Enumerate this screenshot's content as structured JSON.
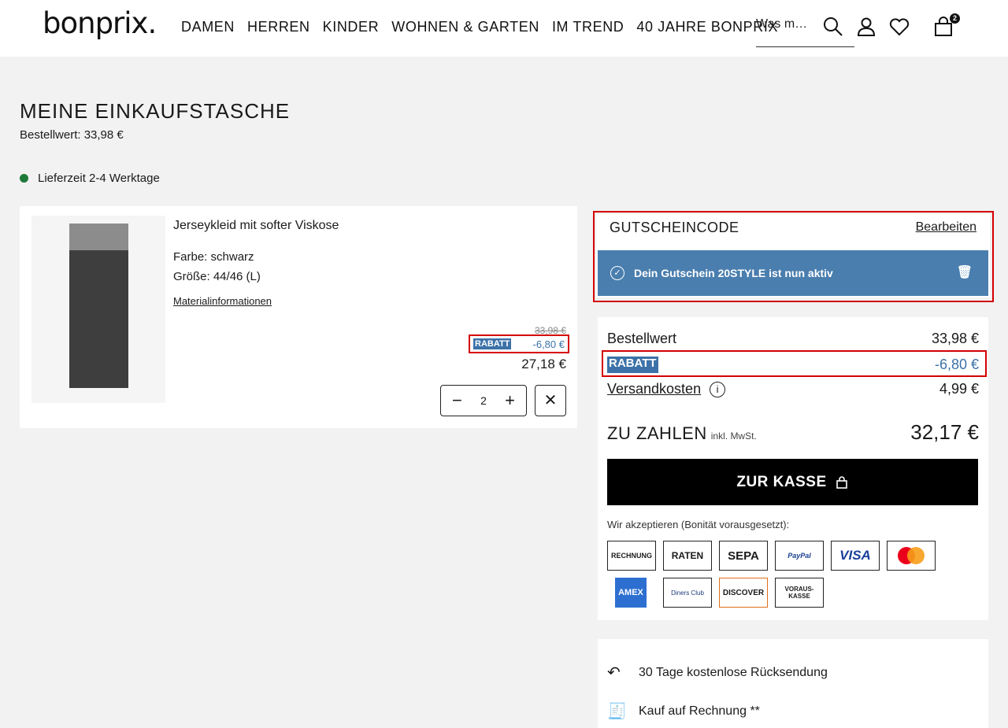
{
  "header": {
    "logo": "bonprix.",
    "nav": [
      "DAMEN",
      "HERREN",
      "KINDER",
      "WOHNEN & GARTEN",
      "IM TREND",
      "40 JAHRE BONPRIX"
    ],
    "search_placeholder": "Was m…",
    "cart_count": "2",
    "icons": [
      "search-icon",
      "user-icon",
      "heart-icon",
      "bag-icon"
    ]
  },
  "page": {
    "title": "MEINE EINKAUFSTASCHE",
    "order_value": "Bestellwert: 33,98 €",
    "delivery": "Lieferzeit 2-4 Werktage"
  },
  "item": {
    "name": "Jerseykleid mit softer Viskose",
    "color": "Farbe: schwarz",
    "size": "Größe: 44/46 (L)",
    "material_link": "Materialinformationen",
    "old_price": "33,98 €",
    "discount_tag": "RABATT",
    "discount": "-6,80 €",
    "price": "27,18 €",
    "quantity": "2",
    "minus": "−",
    "plus": "+",
    "remove": "✕"
  },
  "voucher": {
    "title": "GUTSCHEINCODE",
    "edit": "Bearbeiten",
    "message": "Dein Gutschein 20STYLE ist nun aktiv"
  },
  "summary": {
    "order_value_label": "Bestellwert",
    "order_value": "33,98 €",
    "discount_tag": "RABATT",
    "discount": "-6,80 €",
    "shipping_label": "Versandkosten",
    "shipping": "4,99 €",
    "pay_label": "ZU ZAHLEN",
    "pay_sub": "inkl. MwSt.",
    "total": "32,17 €",
    "checkout": "ZUR KASSE",
    "accept": "Wir akzeptieren (Bonität vorausgesetzt):",
    "payment_methods": [
      "RECHNUNG",
      "RATEN",
      "SEPA",
      "PayPal",
      "VISA",
      "",
      "AMEX",
      "Diners Club",
      "DISCOVER",
      "VORAUS-KASSE"
    ]
  },
  "service": {
    "returns": "30 Tage kostenlose Rücksendung",
    "invoice": "Kauf auf Rechnung **"
  },
  "colors": {
    "accent_blue": "#3c72a8",
    "voucher_blue": "#4a7eae",
    "highlight_red": "#d40000",
    "delivery_green": "#1f7a3a"
  }
}
